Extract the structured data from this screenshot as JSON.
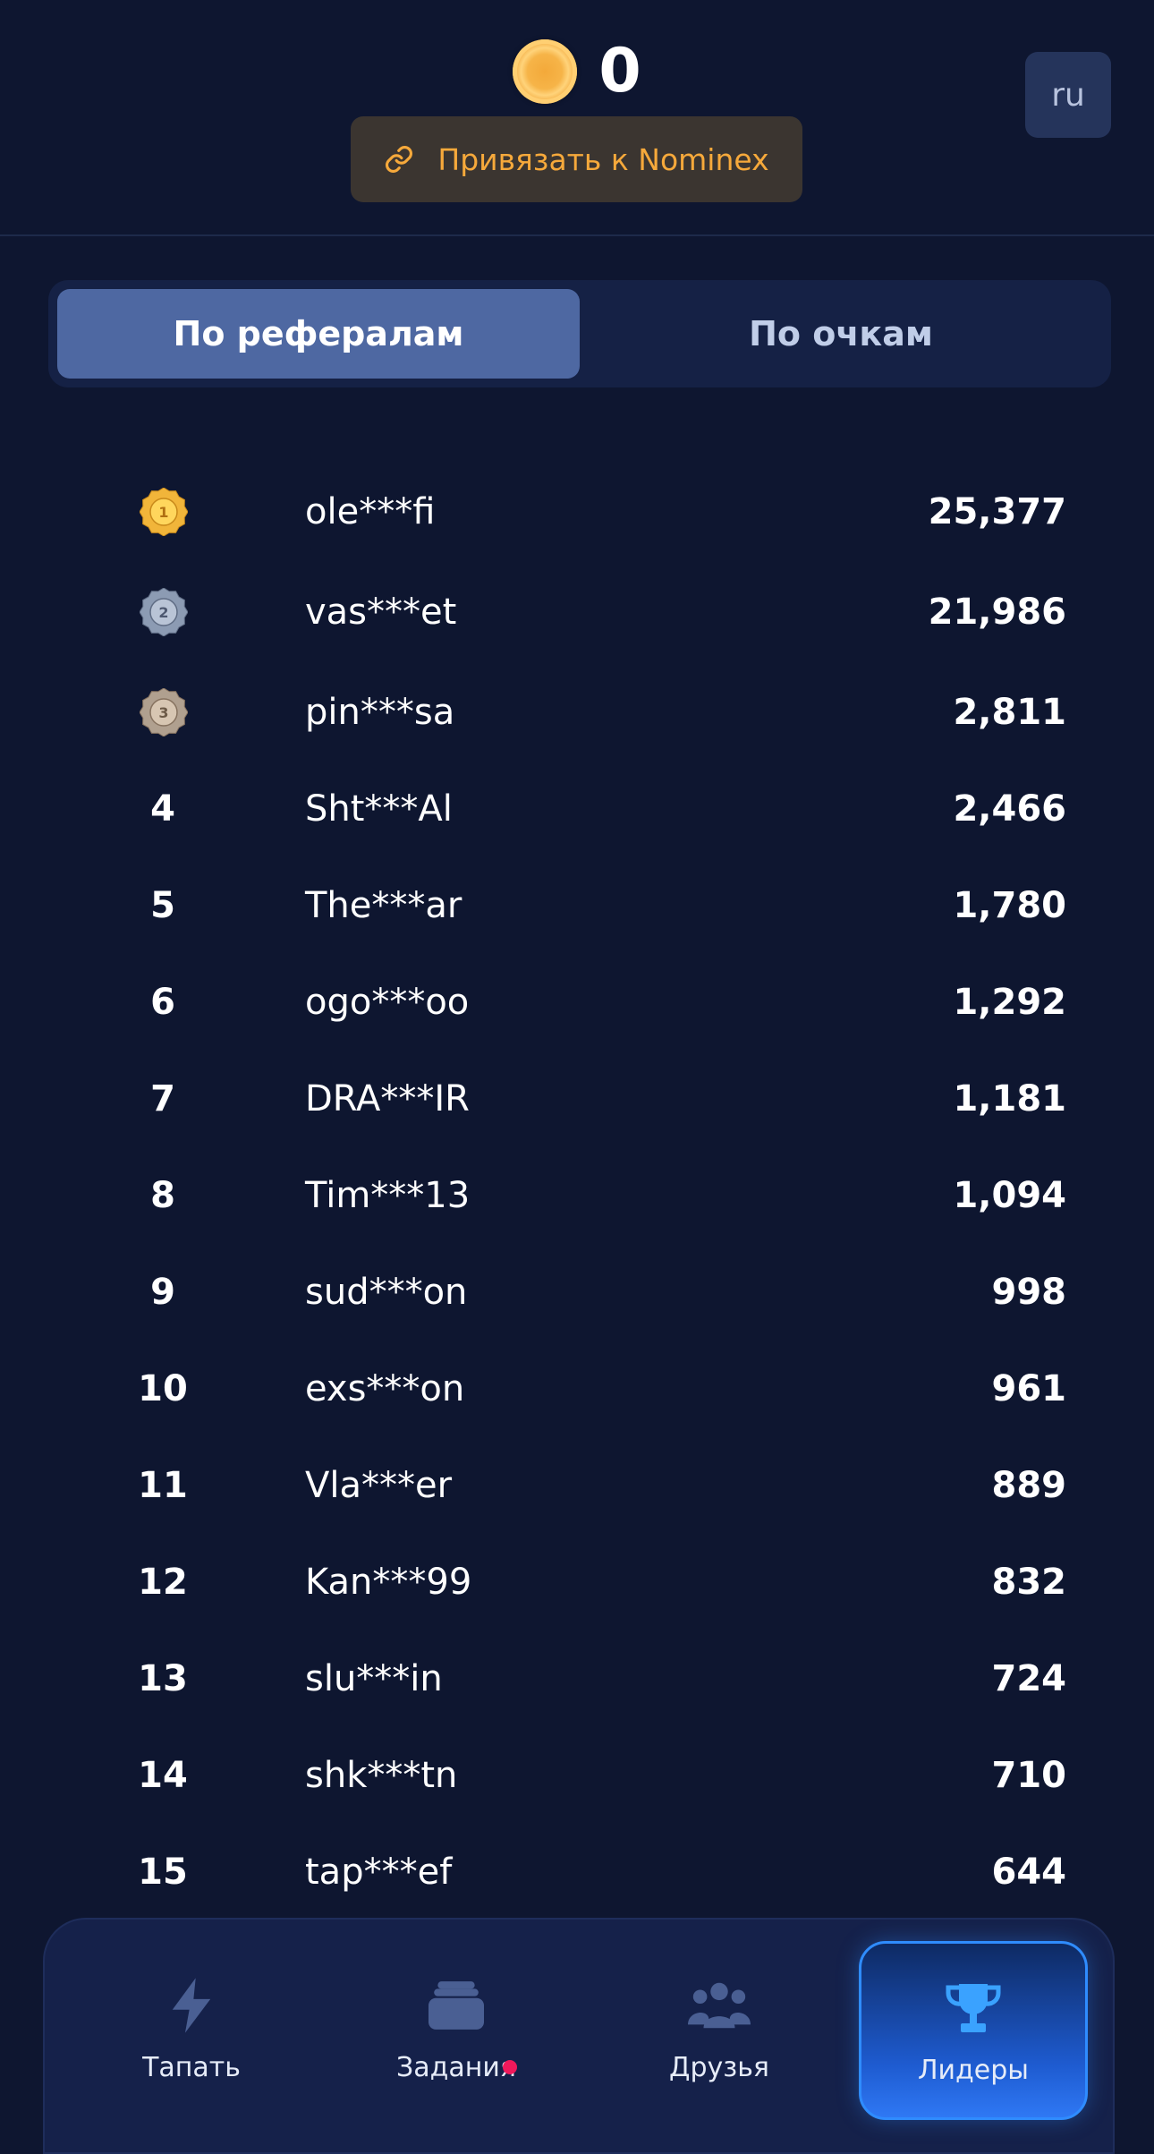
{
  "header": {
    "balance": "0",
    "lang": "ru",
    "link_label": "Привязать к Nominex"
  },
  "tabs": [
    {
      "label": "По рефералам",
      "active": true
    },
    {
      "label": "По очкам",
      "active": false
    }
  ],
  "leaderboard": [
    {
      "rank": "1",
      "medal": "gold",
      "name": "ole***fi",
      "score": "25,377"
    },
    {
      "rank": "2",
      "medal": "silver",
      "name": "vas***et",
      "score": "21,986"
    },
    {
      "rank": "3",
      "medal": "bronze",
      "name": "pin***sa",
      "score": "2,811"
    },
    {
      "rank": "4",
      "name": "Sht***Al",
      "score": "2,466"
    },
    {
      "rank": "5",
      "name": "The***ar",
      "score": "1,780"
    },
    {
      "rank": "6",
      "name": "ogo***oo",
      "score": "1,292"
    },
    {
      "rank": "7",
      "name": "DRA***IR",
      "score": "1,181"
    },
    {
      "rank": "8",
      "name": "Tim***13",
      "score": "1,094"
    },
    {
      "rank": "9",
      "name": "sud***on",
      "score": "998"
    },
    {
      "rank": "10",
      "name": "exs***on",
      "score": "961"
    },
    {
      "rank": "11",
      "name": "Vla***er",
      "score": "889"
    },
    {
      "rank": "12",
      "name": "Kan***99",
      "score": "832"
    },
    {
      "rank": "13",
      "name": "slu***in",
      "score": "724"
    },
    {
      "rank": "14",
      "name": "shk***tn",
      "score": "710"
    },
    {
      "rank": "15",
      "name": "tap***ef",
      "score": "644"
    }
  ],
  "nav": [
    {
      "label": "Тапать",
      "icon": "lightning-icon",
      "active": false
    },
    {
      "label": "Задания",
      "icon": "tasks-icon",
      "active": false,
      "badge": true
    },
    {
      "label": "Друзья",
      "icon": "friends-icon",
      "active": false
    },
    {
      "label": "Лидеры",
      "icon": "trophy-icon",
      "active": true
    }
  ],
  "colors": {
    "background": "#0e1630",
    "accent": "#f6a93b",
    "active_nav": "#2f78f4",
    "badge": "#f0195b"
  }
}
